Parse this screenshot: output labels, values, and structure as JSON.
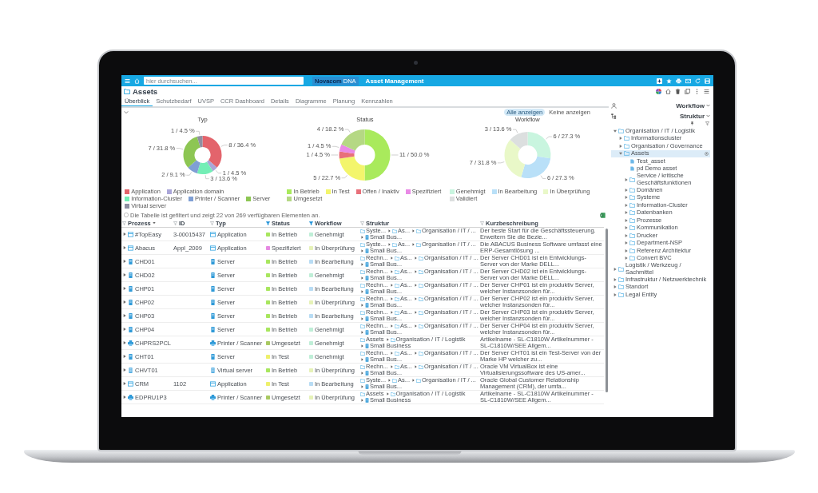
{
  "topbar": {
    "search": {
      "placeholder": "hier durchsuchen..."
    },
    "logo": {
      "brand": "Novacom",
      "product": "DNA"
    },
    "title": "Asset Management"
  },
  "page": {
    "title": "Assets"
  },
  "tabs": [
    {
      "label": "Überblick",
      "selected": true
    },
    {
      "label": "Schutzbedarf",
      "selected": false
    },
    {
      "label": "UVSP",
      "selected": false
    },
    {
      "label": "CCR Dashboard",
      "selected": false
    },
    {
      "label": "Details",
      "selected": false
    },
    {
      "label": "Diagramme",
      "selected": false
    },
    {
      "label": "Planung",
      "selected": false
    },
    {
      "label": "Kennzahlen",
      "selected": false
    }
  ],
  "overview": {
    "expanded": true,
    "filter_buttons": [
      {
        "label": "Alle anzeigen",
        "selected": true
      },
      {
        "label": "Keine anzeigen",
        "selected": false
      }
    ],
    "charts": [
      {
        "chart_data": {
          "type": "donut",
          "title": "Typ",
          "legend": "bottom",
          "categories": [
            "Application",
            "Application domain",
            "Information-Cluster",
            "Printer / Scanner",
            "Server",
            "Virtual server"
          ],
          "values": [
            8,
            1,
            3,
            2,
            7,
            1
          ],
          "value_labels": [
            "8 / 36.4 %",
            "1 / 4.5 %",
            "3 / 13.6 %",
            "2 / 9.1 %",
            "7 / 31.8 %",
            "1 / 4.5 %"
          ],
          "colors": [
            "#e3646c",
            "#aaa6d8",
            "#74eeb6",
            "#7f9fd4",
            "#8dc653",
            "#8e90a2"
          ]
        }
      },
      {
        "chart_data": {
          "type": "donut",
          "title": "Status",
          "legend": "bottom",
          "categories": [
            "In Betrieb",
            "In Test",
            "Offen / Inaktiv",
            "Spezifiziert",
            "Umgesetzt"
          ],
          "values": [
            11,
            5,
            1,
            1,
            4
          ],
          "value_labels": [
            "11 / 50.0 %",
            "5 / 22.7 %",
            "1 / 4.5 %",
            "1 / 4.5 %",
            "4 / 18.2 %"
          ],
          "colors": [
            "#a9ea5c",
            "#f3f56c",
            "#e8707a",
            "#e98ae6",
            "#b5d884"
          ]
        }
      },
      {
        "chart_data": {
          "type": "donut",
          "title": "Workflow",
          "legend": "bottom",
          "categories": [
            "Genehmigt",
            "In Bearbeitung",
            "In Überprüfung",
            "Validiert"
          ],
          "values": [
            6,
            6,
            7,
            3
          ],
          "value_labels": [
            "6 / 27.3 %",
            "6 / 27.3 %",
            "7 / 31.8 %",
            "3 / 13.6 %"
          ],
          "colors": [
            "#c9f5df",
            "#b9e0f8",
            "#e9f8c8",
            "#dcdfdf"
          ]
        }
      }
    ]
  },
  "table": {
    "notice": {
      "text": "Die Tabelle ist gefiltert und zeigt 22 von 269 verfügbaren Elementen an.",
      "checked": false
    },
    "columns": [
      {
        "label": "Prozess",
        "filtered": false,
        "sorted": true
      },
      {
        "label": "ID",
        "filtered": false,
        "sorted": false
      },
      {
        "label": "Typ",
        "filtered": false,
        "sorted": false
      },
      {
        "label": "Status",
        "filtered": true,
        "sorted": false
      },
      {
        "label": "Workflow",
        "filtered": true,
        "sorted": false
      },
      {
        "label": "Struktur",
        "filtered": false,
        "sorted": false
      },
      {
        "label": "Kurzbeschreibung",
        "filtered": false,
        "sorted": false
      }
    ],
    "rows": [
      {
        "expanded": false,
        "kind": "application",
        "name": "#TopEasy",
        "id": "3-00015437",
        "type": "Application",
        "status": {
          "label": "In Betrieb",
          "color": "#a8e65e"
        },
        "workflow": {
          "label": "Genehmigt",
          "color": "#bfeed7"
        },
        "structure": [
          "Syste...",
          "As...",
          "Organisation / IT / ...",
          "Small Bus..."
        ],
        "description": "Der beste Start für die Geschäftssteuerung. Erweitern Sie die Bezie..."
      },
      {
        "expanded": false,
        "kind": "application",
        "name": "Abacus",
        "id": "Appl_2009",
        "type": "Application",
        "status": {
          "label": "Spezifiziert",
          "color": "#e68ae2"
        },
        "workflow": {
          "label": "In Überprüfung",
          "color": "#e6f2b8"
        },
        "structure": [
          "Syste...",
          "As...",
          "Organisation / IT / ...",
          "Small Bus..."
        ],
        "description": "Die ABACUS Business Software umfasst eine ERP-Gesamtlösung ..."
      },
      {
        "expanded": false,
        "kind": "server",
        "name": "CHD01",
        "type": "Server",
        "status": {
          "label": "In Betrieb",
          "color": "#a8e65e"
        },
        "workflow": {
          "label": "In Bearbeitung",
          "color": "#b8dcf4"
        },
        "structure": [
          "Rechn...",
          "As...",
          "Organisation / IT / ...",
          "Small Bus..."
        ],
        "description": "Der Server CHD01 ist ein Entwicklungs-Server von der Marke DELL..."
      },
      {
        "expanded": false,
        "kind": "server",
        "name": "CHD02",
        "type": "Server",
        "status": {
          "label": "In Betrieb",
          "color": "#a8e65e"
        },
        "workflow": {
          "label": "Genehmigt",
          "color": "#bfeed7"
        },
        "structure": [
          "Rechn...",
          "As...",
          "Organisation / IT / ...",
          "Small Bus..."
        ],
        "description": "Der Server CHD02 ist ein Entwicklungs-Server von der Marke DELL..."
      },
      {
        "expanded": false,
        "kind": "server",
        "name": "CHP01",
        "type": "Server",
        "status": {
          "label": "In Betrieb",
          "color": "#a8e65e"
        },
        "workflow": {
          "label": "In Bearbeitung",
          "color": "#b8dcf4"
        },
        "structure": [
          "Rechn...",
          "As...",
          "Organisation / IT / ...",
          "Small Bus..."
        ],
        "description": "Der Server CHP01 ist ein produktiv Server, welcher Instanzsonden für..."
      },
      {
        "expanded": false,
        "kind": "server",
        "name": "CHP02",
        "type": "Server",
        "status": {
          "label": "In Betrieb",
          "color": "#a8e65e"
        },
        "workflow": {
          "label": "In Überprüfung",
          "color": "#e6f2b8"
        },
        "structure": [
          "Rechn...",
          "As...",
          "Organisation / IT / ...",
          "Small Bus..."
        ],
        "description": "Der Server CHP02 ist ein produktiv Server, welcher Instanzsonden für..."
      },
      {
        "expanded": false,
        "kind": "server",
        "name": "CHP03",
        "type": "Server",
        "status": {
          "label": "In Betrieb",
          "color": "#a8e65e"
        },
        "workflow": {
          "label": "In Bearbeitung",
          "color": "#b8dcf4"
        },
        "structure": [
          "Rechn...",
          "As...",
          "Organisation / IT / ...",
          "Small Bus..."
        ],
        "description": "Der Server CHP03 ist ein produktiv Server, welcher Instanzsonden für..."
      },
      {
        "expanded": false,
        "kind": "server",
        "name": "CHP04",
        "type": "Server",
        "status": {
          "label": "In Betrieb",
          "color": "#a8e65e"
        },
        "workflow": {
          "label": "Genehmigt",
          "color": "#bfeed7"
        },
        "structure": [
          "Rechn...",
          "As...",
          "Organisation / IT / ...",
          "Small Bus..."
        ],
        "description": "Der Server CHP04 ist ein produktiv Server, welcher Instanzsonden für..."
      },
      {
        "expanded": false,
        "kind": "printer",
        "name": "CHPRS2PCL",
        "type": "Printer / Scanner",
        "status": {
          "label": "Umgesetzt",
          "color": "#a9c962"
        },
        "workflow": {
          "label": "Genehmigt",
          "color": "#bfeed7"
        },
        "structure": [
          "Assets",
          "Organisation / IT / Logistik",
          "Small Business"
        ],
        "description": "Artikelname - SL-C1810W Artikelnummer - SL-C1810W/SEE Allgem..."
      },
      {
        "expanded": false,
        "kind": "server",
        "name": "CHT01",
        "type": "Server",
        "status": {
          "label": "In Test",
          "color": "#eef06c"
        },
        "workflow": {
          "label": "Genehmigt",
          "color": "#bfeed7"
        },
        "structure": [
          "Rechn...",
          "As...",
          "Organisation / IT / ...",
          "Small Bus..."
        ],
        "description": "Der Server CHT01 ist ein Test-Server von der Marke HP welcher zu..."
      },
      {
        "expanded": false,
        "kind": "virtual_server",
        "name": "CHVT01",
        "type": "Virtual server",
        "status": {
          "label": "In Betrieb",
          "color": "#a8e65e"
        },
        "workflow": {
          "label": "In Überprüfung",
          "color": "#e6f2b8"
        },
        "structure": [
          "Rechn...",
          "As...",
          "Organisation / IT / ...",
          "Small Bus..."
        ],
        "description": "Oracle VM VirtualBox ist eine Virtualisierungssoftware des US-amer..."
      },
      {
        "expanded": false,
        "kind": "application",
        "name": "CRM",
        "id": "1102",
        "type": "Application",
        "status": {
          "label": "In Test",
          "color": "#eef06c"
        },
        "workflow": {
          "label": "In Bearbeitung",
          "color": "#b8dcf4"
        },
        "structure": [
          "Syste...",
          "As...",
          "Organisation / IT / ...",
          "Small Bus..."
        ],
        "description": "Oracle Global Customer Relationship Management (CRM), der umfa..."
      },
      {
        "expanded": false,
        "kind": "printer",
        "name": "EDPRU1P3",
        "type": "Printer / Scanner",
        "status": {
          "label": "Umgesetzt",
          "color": "#a9c962"
        },
        "workflow": {
          "label": "In Überprüfung",
          "color": "#e6f2b8"
        },
        "structure": [
          "Assets",
          "Organisation / IT / Logistik",
          "Small Business"
        ],
        "description": "Artikelname - SL-C1810W Artikelnummer - SL-C1810W/SEE Allgem..."
      }
    ]
  },
  "sidebar": {
    "view_menu": "Workflow",
    "tree_menu": "Struktur",
    "tree": [
      {
        "label": "Organisation / IT / Logistik",
        "kind": "folder",
        "expanded": true,
        "selected": false,
        "children": [
          {
            "label": "Informationscluster",
            "kind": "folder",
            "expanded": false,
            "selected": false
          },
          {
            "label": "Organisation / Governance",
            "kind": "folder",
            "expanded": false,
            "selected": false
          },
          {
            "label": "Assets",
            "kind": "folder",
            "expanded": true,
            "selected": true,
            "children": [
              {
                "label": "Test_asset",
                "kind": "item",
                "selected": false
              },
              {
                "label": "pd Demo asset",
                "kind": "item",
                "selected": false
              },
              {
                "label": "Service / kritische Geschäftsfunktionen",
                "kind": "folder",
                "expanded": false,
                "selected": false
              },
              {
                "label": "Domänen",
                "kind": "folder",
                "expanded": false,
                "selected": false
              },
              {
                "label": "Systeme",
                "kind": "folder",
                "expanded": false,
                "selected": false
              },
              {
                "label": "Information-Cluster",
                "kind": "folder",
                "expanded": false,
                "selected": false
              },
              {
                "label": "Datenbanken",
                "kind": "folder",
                "expanded": false,
                "selected": false
              },
              {
                "label": "Prozesse",
                "kind": "folder",
                "expanded": false,
                "selected": false
              },
              {
                "label": "Kommunikation",
                "kind": "folder",
                "expanded": false,
                "selected": false
              },
              {
                "label": "Drucker",
                "kind": "folder",
                "expanded": false,
                "selected": false
              },
              {
                "label": "Department-NSP",
                "kind": "folder",
                "expanded": false,
                "selected": false
              },
              {
                "label": "Referenz Architektur",
                "kind": "folder",
                "expanded": false,
                "selected": false
              },
              {
                "label": "Convert BVC",
                "kind": "folder",
                "expanded": false,
                "selected": false
              }
            ]
          }
        ]
      },
      {
        "label": "Logistik / Werkzeug / Sachmittel",
        "kind": "folder",
        "expanded": false,
        "selected": false
      },
      {
        "label": "Infrastruktur / Netzwerktechnik",
        "kind": "folder",
        "expanded": false,
        "selected": false
      },
      {
        "label": "Standort",
        "kind": "folder",
        "expanded": false,
        "selected": false
      },
      {
        "label": "Legal Entity",
        "kind": "folder",
        "expanded": false,
        "selected": false
      }
    ]
  }
}
